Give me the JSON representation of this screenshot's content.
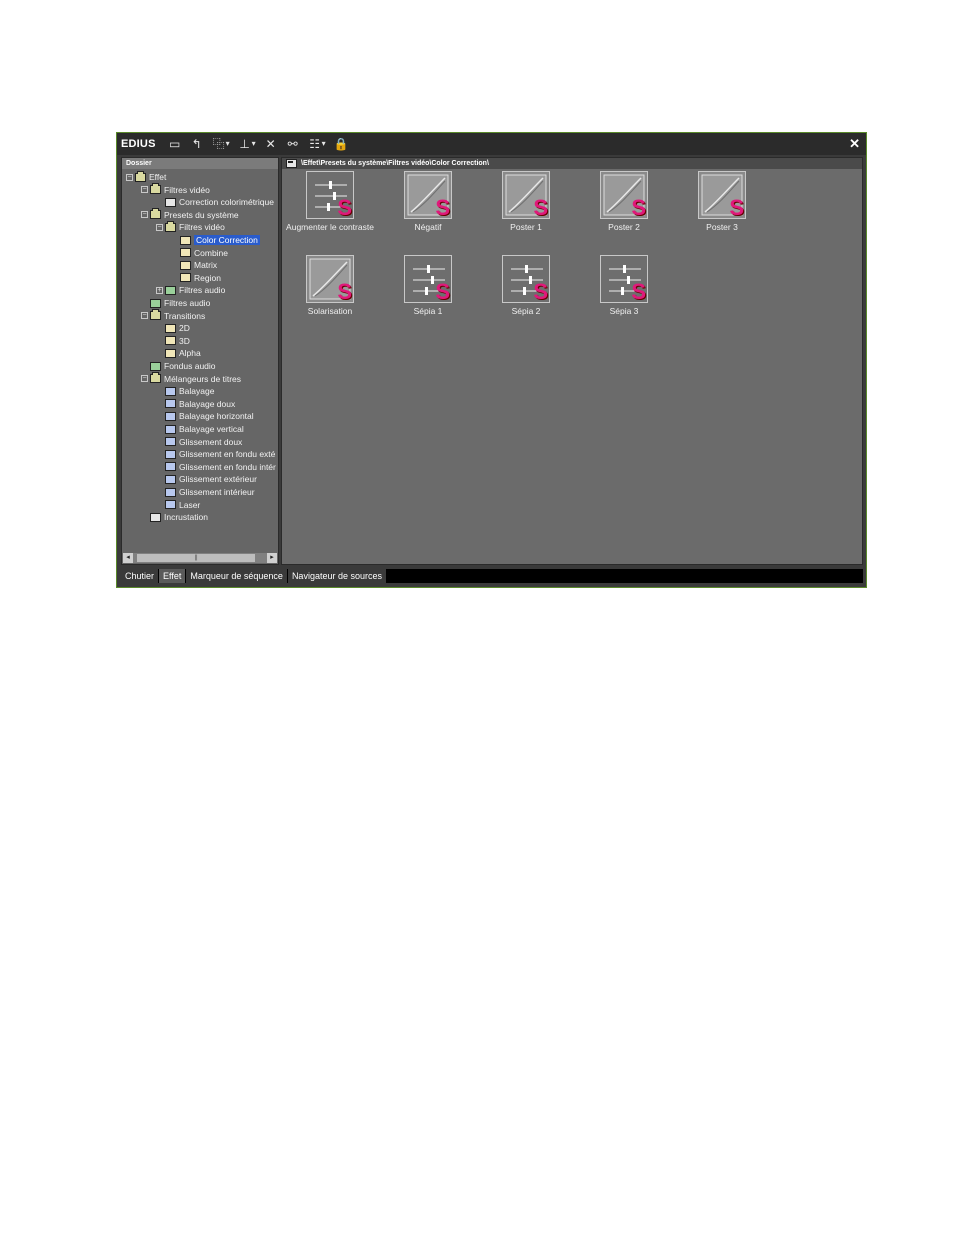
{
  "window": {
    "title": "EDIUS",
    "toolbar": [
      {
        "name": "new-folder-icon",
        "glyph": "▭"
      },
      {
        "name": "up-folder-icon",
        "glyph": "↰"
      },
      {
        "name": "view-folder-icon",
        "glyph": "⿻"
      },
      {
        "name": "dropdown-icon",
        "glyph": "▾"
      },
      {
        "name": "add-icon",
        "glyph": "⊥"
      },
      {
        "name": "dropdown-icon",
        "glyph": "▾"
      },
      {
        "name": "delete-icon",
        "glyph": "✕"
      },
      {
        "name": "effect-settings-icon",
        "glyph": "⚯"
      },
      {
        "name": "view-mode-icon",
        "glyph": "☷"
      },
      {
        "name": "dropdown-icon",
        "glyph": "▾"
      },
      {
        "name": "lock-icon",
        "glyph": "🔒"
      }
    ],
    "close_glyph": "✕"
  },
  "left_panel": {
    "header": "Dossier",
    "tree": [
      {
        "label": "Effet",
        "level": 0,
        "toggle": "−",
        "icon": "folder"
      },
      {
        "label": "Filtres vidéo",
        "level": 1,
        "toggle": "−",
        "icon": "folder"
      },
      {
        "label": "Correction colorimétrique",
        "level": 2,
        "toggle": "",
        "icon": "box"
      },
      {
        "label": "Presets du système",
        "level": 1,
        "toggle": "−",
        "icon": "folder"
      },
      {
        "label": "Filtres vidéo",
        "level": 2,
        "toggle": "−",
        "icon": "folder"
      },
      {
        "label": "Color Correction",
        "level": 3,
        "toggle": "",
        "icon": "grid",
        "selected": true
      },
      {
        "label": "Combine",
        "level": 3,
        "toggle": "",
        "icon": "grid"
      },
      {
        "label": "Matrix",
        "level": 3,
        "toggle": "",
        "icon": "grid"
      },
      {
        "label": "Region",
        "level": 3,
        "toggle": "",
        "icon": "grid"
      },
      {
        "label": "Filtres audio",
        "level": 2,
        "toggle": "+",
        "icon": "fx"
      },
      {
        "label": "Filtres audio",
        "level": 1,
        "toggle": "",
        "icon": "fx"
      },
      {
        "label": "Transitions",
        "level": 1,
        "toggle": "−",
        "icon": "folder"
      },
      {
        "label": "2D",
        "level": 2,
        "toggle": "",
        "icon": "grid"
      },
      {
        "label": "3D",
        "level": 2,
        "toggle": "",
        "icon": "grid"
      },
      {
        "label": "Alpha",
        "level": 2,
        "toggle": "",
        "icon": "grid"
      },
      {
        "label": "Fondus audio",
        "level": 1,
        "toggle": "",
        "icon": "fx"
      },
      {
        "label": "Mélangeurs de titres",
        "level": 1,
        "toggle": "−",
        "icon": "folder"
      },
      {
        "label": "Balayage",
        "level": 2,
        "toggle": "",
        "icon": "title"
      },
      {
        "label": "Balayage doux",
        "level": 2,
        "toggle": "",
        "icon": "title"
      },
      {
        "label": "Balayage horizontal",
        "level": 2,
        "toggle": "",
        "icon": "title"
      },
      {
        "label": "Balayage vertical",
        "level": 2,
        "toggle": "",
        "icon": "title"
      },
      {
        "label": "Glissement doux",
        "level": 2,
        "toggle": "",
        "icon": "title"
      },
      {
        "label": "Glissement en fondu exté",
        "level": 2,
        "toggle": "",
        "icon": "title"
      },
      {
        "label": "Glissement en fondu intér",
        "level": 2,
        "toggle": "",
        "icon": "title"
      },
      {
        "label": "Glissement extérieur",
        "level": 2,
        "toggle": "",
        "icon": "title"
      },
      {
        "label": "Glissement intérieur",
        "level": 2,
        "toggle": "",
        "icon": "title"
      },
      {
        "label": "Laser",
        "level": 2,
        "toggle": "",
        "icon": "title"
      },
      {
        "label": "Incrustation",
        "level": 1,
        "toggle": "",
        "icon": "inc"
      }
    ],
    "scroll_left": "◂",
    "scroll_right": "▸",
    "scroll_thumb": "||"
  },
  "right_panel": {
    "path": "\\Effet\\Presets du système\\Filtres vidéo\\Color Correction\\",
    "items": [
      {
        "label": "Augmenter le contraste",
        "kind": "sliders",
        "badge": "S"
      },
      {
        "label": "Négatif",
        "kind": "curve",
        "badge": "S"
      },
      {
        "label": "Poster 1",
        "kind": "curve",
        "badge": "S"
      },
      {
        "label": "Poster 2",
        "kind": "curve",
        "badge": "S"
      },
      {
        "label": "Poster 3",
        "kind": "curve",
        "badge": "S"
      },
      {
        "label": "Solarisation",
        "kind": "curve",
        "badge": "S"
      },
      {
        "label": "Sépia 1",
        "kind": "sliders",
        "badge": "S"
      },
      {
        "label": "Sépia 2",
        "kind": "sliders",
        "badge": "S"
      },
      {
        "label": "Sépia 3",
        "kind": "sliders",
        "badge": "S"
      }
    ]
  },
  "tabs": [
    {
      "label": "Chutier",
      "active": false
    },
    {
      "label": "Effet",
      "active": true
    },
    {
      "label": "Marqueur de séquence",
      "active": false
    },
    {
      "label": "Navigateur de sources",
      "active": false
    }
  ],
  "colors": {
    "badge": "#e0187a",
    "selection": "#2a5ccc",
    "window_border": "#5a8a2a"
  }
}
